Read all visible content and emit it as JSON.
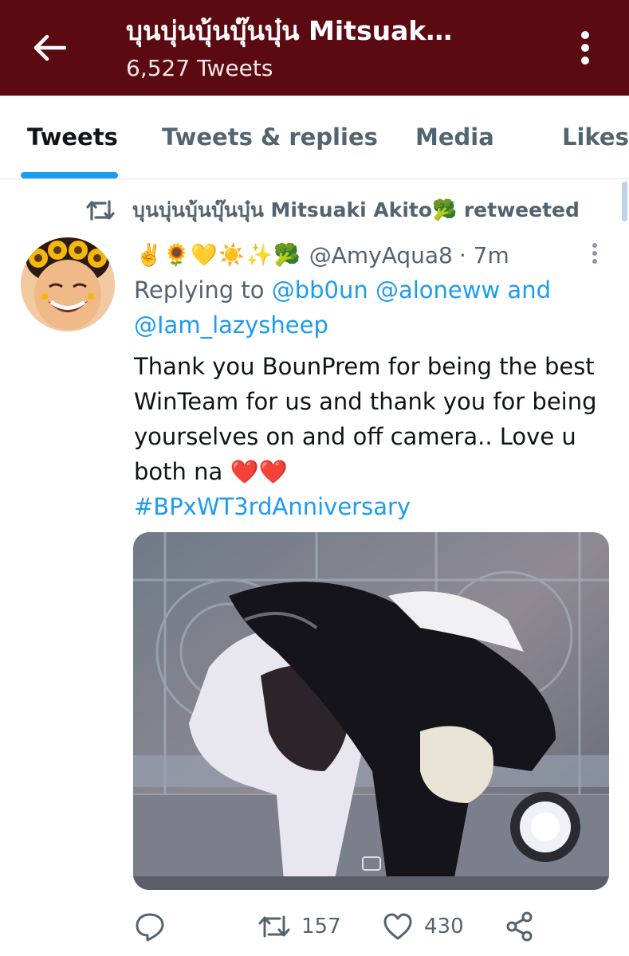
{
  "header": {
    "title": "บุนบุ่นบุ้นบุ๊นบุ๋น Mitsuak…",
    "tweet_count": "6,527 Tweets",
    "bg_color": "#5b0a12",
    "back_icon": "arrow-left-icon",
    "more_icon": "vertical-dots-icon"
  },
  "tabs": [
    {
      "label": "Tweets",
      "active": true
    },
    {
      "label": "Tweets & replies",
      "active": false
    },
    {
      "label": "Media",
      "active": false
    },
    {
      "label": "Likes",
      "active": false
    }
  ],
  "retweet": {
    "text": "บุนบุ่นบุ้นบุ๊นบุ๋น Mitsuaki Akito🥦 retweeted",
    "icon": "retweet-icon"
  },
  "tweet": {
    "display_name": "✌️🌻💛☀️✨🥦",
    "handle": "@AmyAqua8",
    "time": "· 7m",
    "replying_prefix": "Replying to",
    "mentions": [
      "@bb0un",
      "@aloneww",
      "@Iam_lazysheep"
    ],
    "and_word": "and",
    "text": "Thank you BounPrem for being the best WinTeam for us and thank you for being yourselves on and off camera.. Love u both na ❤️❤️",
    "hashtag": "#BPxWT3rdAnniversary",
    "media_icon": "photo-icon"
  },
  "actions": {
    "reply_icon": "reply-bubble-icon",
    "retweet_count": "157",
    "like_count": "430",
    "share_icon": "share-icon"
  },
  "colors": {
    "accent": "#1d9bf0",
    "secondary_text": "#536471",
    "like_heart": "#e0245e"
  }
}
